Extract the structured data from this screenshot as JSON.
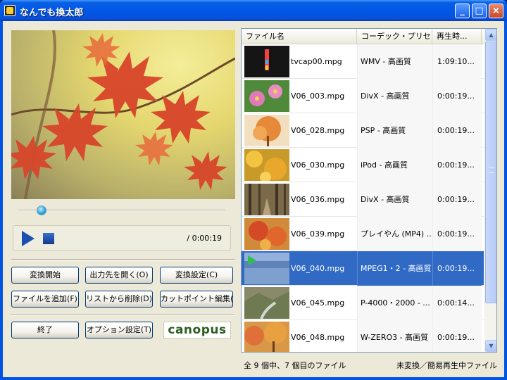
{
  "window": {
    "title": "なんでも換太郎",
    "min_glyph": "_",
    "max_glyph": "□",
    "close_glyph": "×"
  },
  "player": {
    "time": "/ 0:00:19",
    "seek_fraction": 0.1
  },
  "buttons": {
    "convert_start": "変換開始",
    "open_output": "出力先を開く(O)",
    "convert_settings": "変換設定(C)",
    "add_file": "ファイルを追加(F)",
    "remove_from_list": "リストから削除(D)",
    "cut_point_edit": "カットポイント編集(E)",
    "exit": "終了",
    "option_settings": "オプション設定(T)"
  },
  "logo": {
    "text": "canopus"
  },
  "file_list": {
    "columns": [
      "ファイル名",
      "コーデック・プリセット",
      "再生時..."
    ],
    "rows": [
      {
        "name": "tvcap00.mpg",
        "codec": "WMV - 高画質",
        "duration": "1:09:10...",
        "thumb": "dark-bars-thumb"
      },
      {
        "name": "V06_003.mpg",
        "codec": "DivX - 高画質",
        "duration": "0:00:19...",
        "thumb": "pink-flowers-thumb"
      },
      {
        "name": "V06_028.mpg",
        "codec": "PSP - 高画質",
        "duration": "0:00:19...",
        "thumb": "autumn-tree-thumb"
      },
      {
        "name": "V06_030.mpg",
        "codec": "iPod - 高画質",
        "duration": "0:00:19...",
        "thumb": "yellow-leaves-thumb"
      },
      {
        "name": "V06_036.mpg",
        "codec": "DivX - 高画質",
        "duration": "0:00:19...",
        "thumb": "forest-path-thumb"
      },
      {
        "name": "V06_039.mpg",
        "codec": "プレイやん (MP4) ...",
        "duration": "0:00:19...",
        "thumb": "red-leaves-thumb"
      },
      {
        "name": "V06_040.mpg",
        "codec": "MPEG1・2 - 高画質",
        "duration": "0:00:19...",
        "thumb": "blue-water-thumb",
        "selected": true
      },
      {
        "name": "V06_045.mpg",
        "codec": "P-4000・2000 - ...",
        "duration": "0:00:14...",
        "thumb": "mountain-stream-thumb"
      },
      {
        "name": "V06_048.mpg",
        "codec": "W-ZERO3 - 高画質",
        "duration": "0:00:19...",
        "thumb": "orange-trees-thumb"
      }
    ]
  },
  "status": {
    "left": "全 9 個中、7 個目のファイル",
    "right": "未変換／簡易再生中ファイル"
  },
  "colors": {
    "titlebar": "#0058e6",
    "selection": "#316ac5",
    "face": "#ece9d8"
  }
}
